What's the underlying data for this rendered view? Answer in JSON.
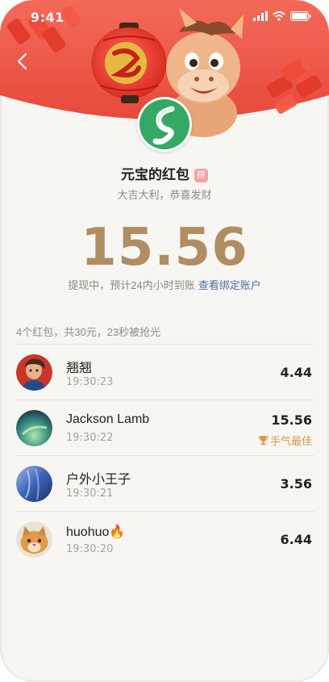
{
  "status_bar": {
    "time": "9:41"
  },
  "packet": {
    "title": "元宝的红包",
    "badge": "拼",
    "blessing": "大吉大利，恭喜发财",
    "amount": "15.56",
    "withdraw_text": "提现中，预计24内小时到账",
    "withdraw_link": "查看绑定账户"
  },
  "summary": "4个红包，共30元，23秒被抢光",
  "records": [
    {
      "name": "翘翘",
      "time": "19:30:23",
      "amount": "4.44"
    },
    {
      "name": "Jackson Lamb",
      "time": "19:30:22",
      "amount": "15.56",
      "badge": "手气最佳"
    },
    {
      "name": "户外小王子",
      "time": "19:30:21",
      "amount": "3.56"
    },
    {
      "name": "huohuo🔥",
      "time": "19:30:20",
      "amount": "6.44"
    }
  ],
  "colors": {
    "header_red": "#ef5a4c",
    "amount_gold": "#b08d63",
    "link_blue": "#4f6fa2",
    "best_gold": "#d79a45"
  }
}
